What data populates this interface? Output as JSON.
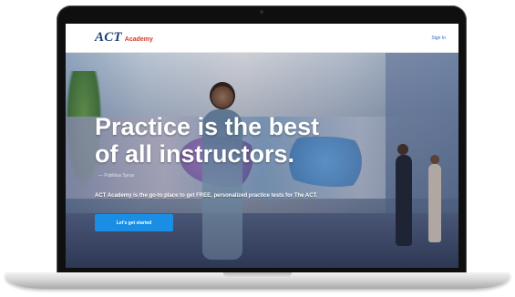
{
  "header": {
    "logo_primary": "ACT",
    "logo_secondary": "Academy",
    "sign_in_label": "Sign In"
  },
  "hero": {
    "headline_line1": "Practice is the best",
    "headline_line2": "of all instructors.",
    "attribution": "— Publilius Syrus",
    "tagline": "ACT Academy is the go-to place to get FREE, personalized practice tests for The ACT.",
    "cta_label": "Let's get started"
  },
  "colors": {
    "brand_blue": "#1f3f7a",
    "brand_red": "#d23a2a",
    "cta_blue": "#1a8ee5",
    "link_blue": "#2a66c9"
  },
  "icons": {
    "camera": "webcam-dot"
  }
}
